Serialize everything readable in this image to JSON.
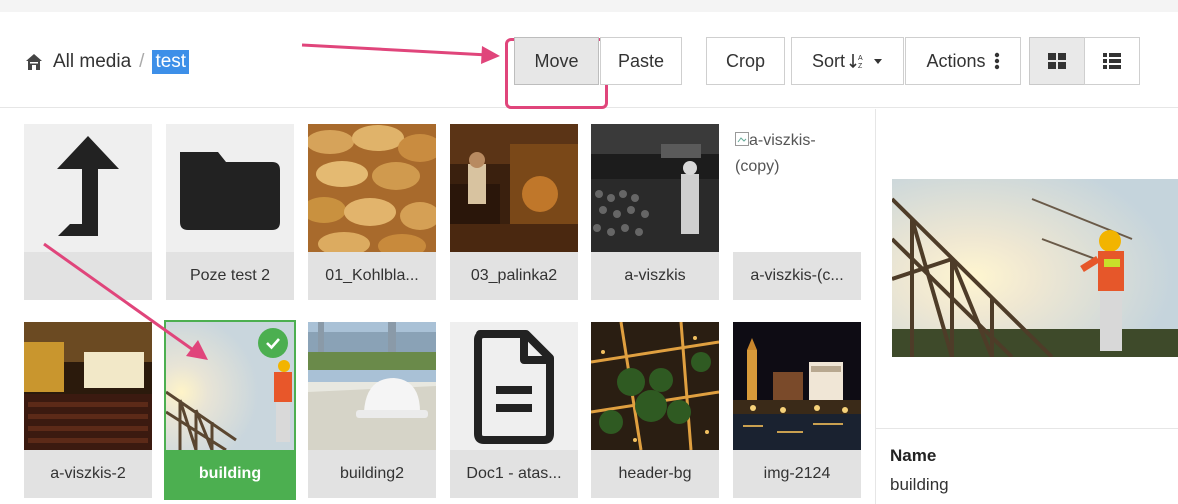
{
  "breadcrumb": {
    "root": "All media",
    "separator": "/",
    "current": "test"
  },
  "toolbar": {
    "move": "Move",
    "paste": "Paste",
    "crop": "Crop",
    "sort": "Sort",
    "actions": "Actions"
  },
  "icons": {
    "home": "home-icon",
    "sort": "sort-alpha-icon",
    "caret": "caret-down-icon",
    "actions": "vertical-ellipsis-icon",
    "grid_view": "grid-view-icon",
    "list_view": "list-view-icon",
    "check": "check-icon"
  },
  "tiles": [
    {
      "label": "",
      "kind": "parent-folder"
    },
    {
      "label": "Poze test 2",
      "kind": "folder"
    },
    {
      "label": "01_Kohlbla...",
      "kind": "image"
    },
    {
      "label": "03_palinka2",
      "kind": "image"
    },
    {
      "label": "a-viszkis",
      "kind": "image"
    },
    {
      "label": "a-viszkis-(c...",
      "kind": "broken-image",
      "alt": "a-viszkis-(copy)"
    },
    {
      "label": "a-viszkis-2",
      "kind": "image"
    },
    {
      "label": "building",
      "kind": "image",
      "selected": true
    },
    {
      "label": "building2",
      "kind": "image"
    },
    {
      "label": "Doc1 - atas...",
      "kind": "document"
    },
    {
      "label": "header-bg",
      "kind": "image"
    },
    {
      "label": "img-2124",
      "kind": "image"
    }
  ],
  "details": {
    "name_label": "Name",
    "name_value": "building"
  },
  "colors": {
    "accent_blue": "#3d8fe8",
    "selected_green": "#4caf50",
    "annotation_pink": "#e0457b"
  }
}
